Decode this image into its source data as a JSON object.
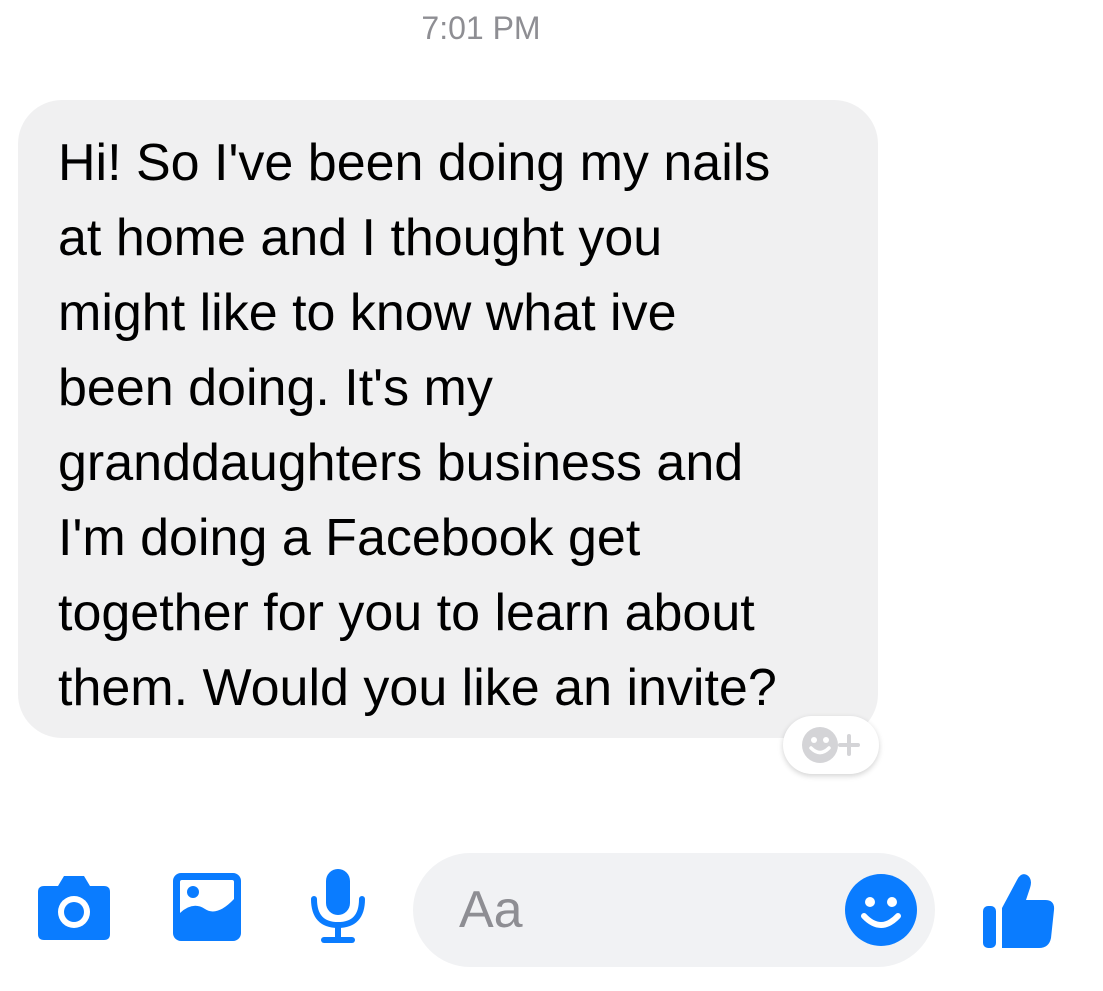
{
  "thread": {
    "timestamp": "7:01 PM",
    "message": {
      "lines": [
        "Hi! So I've been doing my nails",
        "at home and I thought you",
        "might like to know what ive",
        "been doing. It's my",
        "granddaughters business and",
        "I'm doing a Facebook get",
        "together for you to learn about",
        "them. Would you like an invite?"
      ],
      "react_icon": "add-reaction-icon"
    }
  },
  "composer": {
    "placeholder": "Aa",
    "icons": {
      "camera": "camera-icon",
      "gallery": "photo-gallery-icon",
      "microphone": "microphone-icon",
      "emoji": "emoji-icon",
      "like": "thumbs-up-icon"
    }
  },
  "colors": {
    "accent": "#0a7cff",
    "bubble": "#f0f0f1",
    "timestamp": "#8e8e93"
  }
}
